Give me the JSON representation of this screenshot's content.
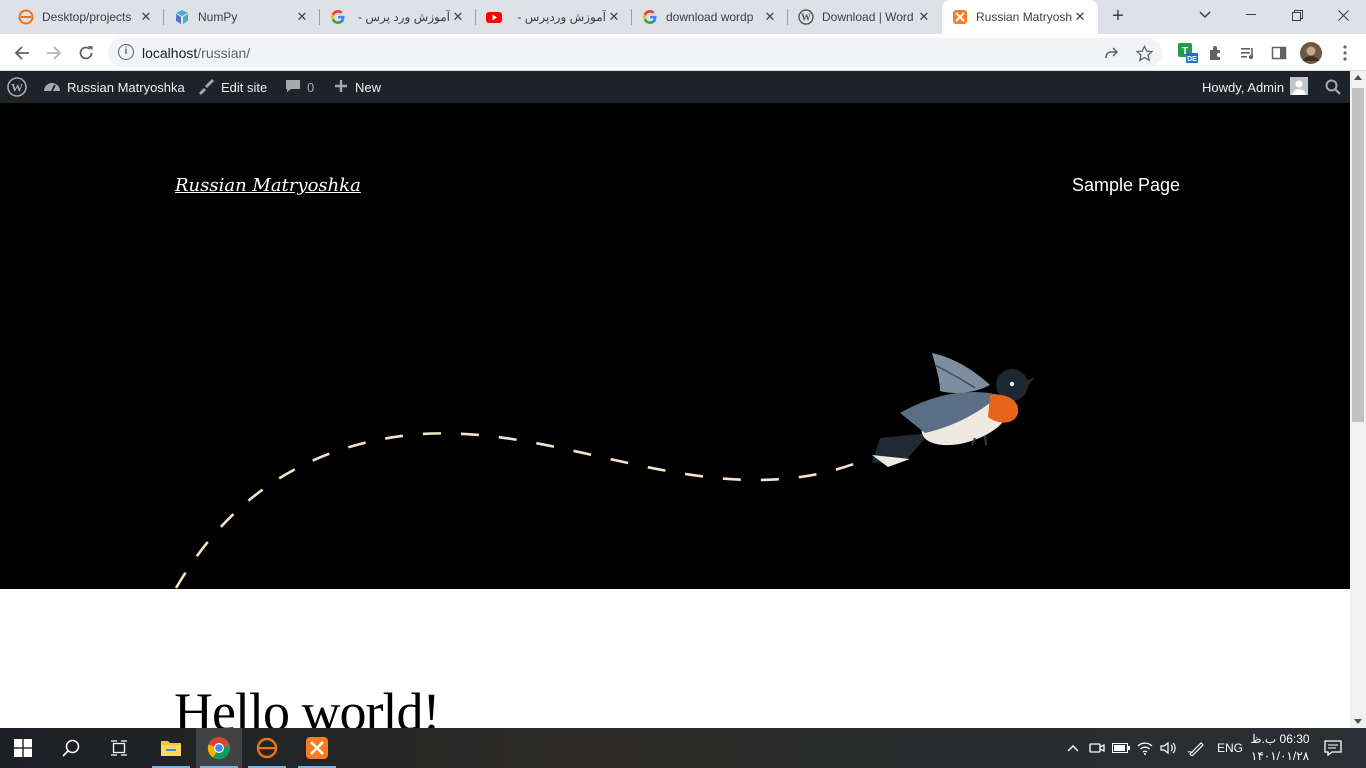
{
  "browser": {
    "tabs": [
      {
        "title": "Desktop/projects",
        "icon": "eclipse-icon"
      },
      {
        "title": "NumPy",
        "icon": "numpy-icon"
      },
      {
        "title": "آموزش ورد پرس -",
        "icon": "google-icon"
      },
      {
        "title": "آموزش وردپرس -",
        "icon": "youtube-icon"
      },
      {
        "title": "download wordp",
        "icon": "google-icon"
      },
      {
        "title": "Download | Word",
        "icon": "wordpress-icon"
      },
      {
        "title": "Russian Matryosh",
        "icon": "xampp-icon",
        "active": true
      }
    ],
    "url_host": "localhost",
    "url_path": "/russian/"
  },
  "adminbar": {
    "site_name": "Russian Matryoshka",
    "edit_site": "Edit site",
    "comments_count": "0",
    "new_label": "New",
    "howdy": "Howdy, Admin"
  },
  "page": {
    "site_title": "Russian Matryoshka",
    "nav_link": "Sample Page",
    "post_title": "Hello world!"
  },
  "taskbar": {
    "language": "ENG",
    "time": "06:30 ب.ظ",
    "date": "۱۴۰۱/۰۱/۲۸"
  },
  "colors": {
    "admin_bar_bg": "#1d2327",
    "hero_bg": "#000000",
    "dash_line": "#f6e3c9",
    "tab_strip": "#dee1e6"
  }
}
